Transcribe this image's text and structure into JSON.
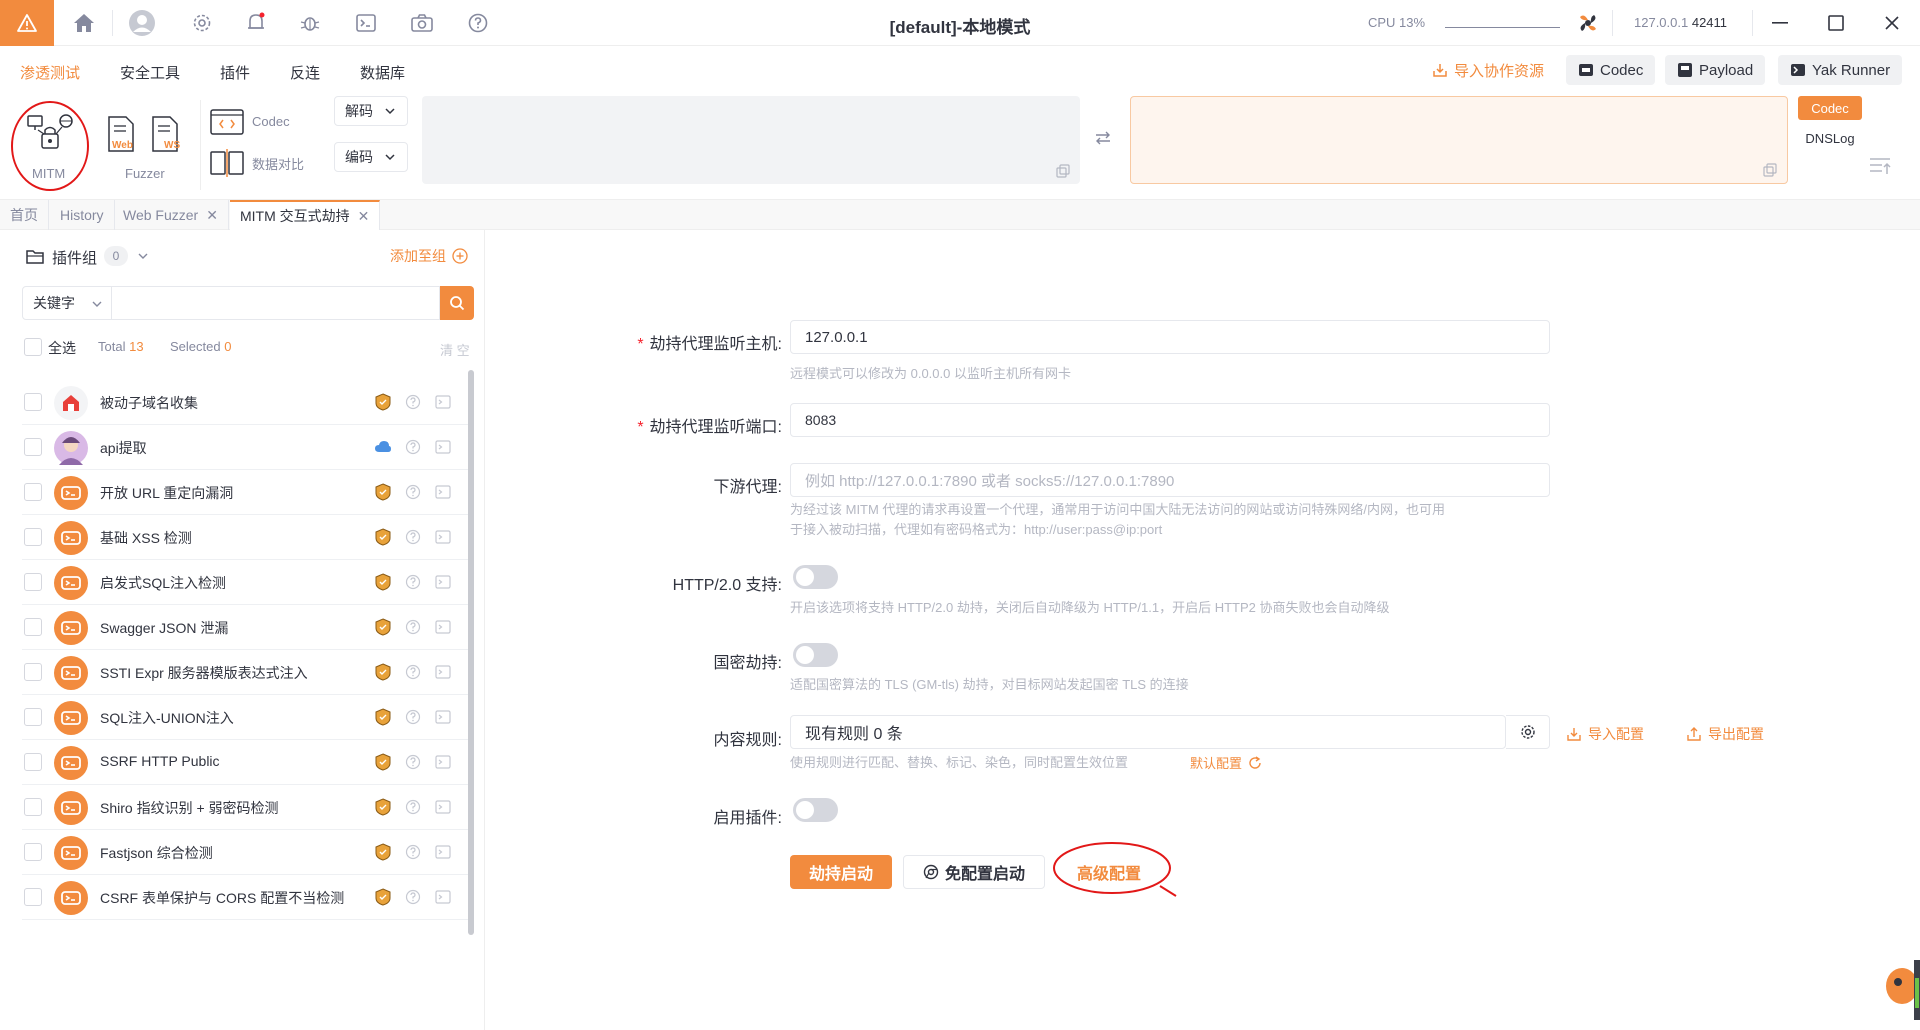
{
  "titlebar": {
    "title": "[default]-本地模式",
    "cpu_label": "CPU 13%",
    "ip": "127.0.0.1",
    "port": "42411"
  },
  "menu": {
    "items": [
      "渗透测试",
      "安全工具",
      "插件",
      "反连",
      "数据库"
    ],
    "import_resources": "导入协作资源",
    "codec": "Codec",
    "payload": "Payload",
    "yak_runner": "Yak Runner"
  },
  "ribbon": {
    "mitm": "MITM",
    "web_label": "Web",
    "ws_label": "WS",
    "fuzzer": "Fuzzer",
    "codec": "Codec",
    "data_compare": "数据对比",
    "decode": "解码",
    "encode": "编码",
    "codec_tab": "Codec",
    "dnslog_tab": "DNSLog"
  },
  "tabs": [
    {
      "label": "首页"
    },
    {
      "label": "History"
    },
    {
      "label": "Web Fuzzer"
    },
    {
      "label": "MITM 交互式劫持"
    }
  ],
  "plugins": {
    "group_label": "插件组",
    "group_count": "0",
    "add_to_group": "添加至组",
    "search_type": "关键字",
    "select_all": "全选",
    "total_label": "Total",
    "total": "13",
    "selected_label": "Selected",
    "selected": "0",
    "clear": "清 空",
    "items": [
      {
        "name": "被动子域名收集",
        "badge": "shield"
      },
      {
        "name": "api提取",
        "badge": "cloud"
      },
      {
        "name": "开放 URL 重定向漏洞",
        "badge": "shield"
      },
      {
        "name": "基础 XSS 检测",
        "badge": "shield"
      },
      {
        "name": "启发式SQL注入检测",
        "badge": "shield"
      },
      {
        "name": "Swagger JSON 泄漏",
        "badge": "shield"
      },
      {
        "name": "SSTI Expr 服务器模版表达式注入",
        "badge": "shield"
      },
      {
        "name": "SQL注入-UNION注入",
        "badge": "shield"
      },
      {
        "name": "SSRF HTTP Public",
        "badge": "shield"
      },
      {
        "name": "Shiro 指纹识别 + 弱密码检测",
        "badge": "shield"
      },
      {
        "name": "Fastjson 综合检测",
        "badge": "shield"
      },
      {
        "name": "CSRF 表单保护与 CORS 配置不当检测",
        "badge": "shield"
      }
    ]
  },
  "form": {
    "host_label": "劫持代理监听主机:",
    "host_value": "127.0.0.1",
    "host_help": "远程模式可以修改为 0.0.0.0 以监听主机所有网卡",
    "port_label": "劫持代理监听端口:",
    "port_value": "8083",
    "downstream_label": "下游代理:",
    "downstream_placeholder": "例如 http://127.0.0.1:7890 或者 socks5://127.0.0.1:7890",
    "downstream_help_1": "为经过该 MITM 代理的请求再设置一个代理，通常用于访问中国大陆无法访问的网站或访问特殊网络/内网，也可用",
    "downstream_help_2": "于接入被动扫描，代理如有密码格式为：http://user:pass@ip:port",
    "http2_label": "HTTP/2.0 支持:",
    "http2_help": "开启该选项将支持 HTTP/2.0 劫持，关闭后自动降级为 HTTP/1.1，开启后 HTTP2 协商失败也会自动降级",
    "gm_label": "国密劫持:",
    "gm_help": "适配国密算法的 TLS (GM-tls) 劫持，对目标网站发起国密 TLS 的连接",
    "rules_label": "内容规则:",
    "rules_value": "现有规则 0 条",
    "import_config": "导入配置",
    "export_config": "导出配置",
    "rules_help": "使用规则进行匹配、替换、标记、染色，同时配置生效位置",
    "default_config": "默认配置",
    "plugin_label": "启用插件:",
    "start": "劫持启动",
    "no_config_start": "免配置启动",
    "advanced": "高级配置"
  }
}
